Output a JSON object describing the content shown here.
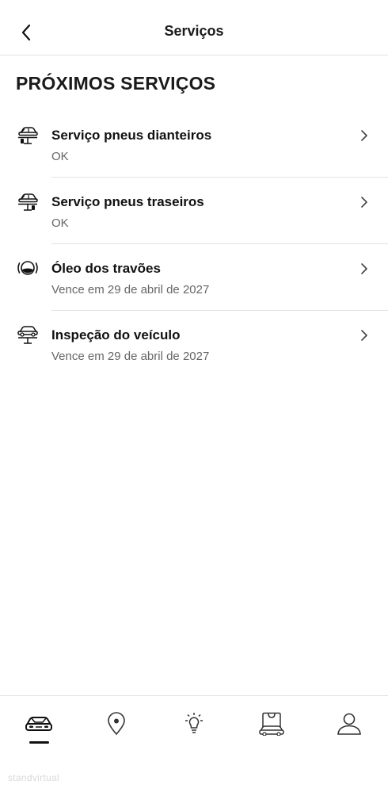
{
  "header": {
    "title": "Serviços",
    "back_icon": "chevron-left-icon"
  },
  "section": {
    "title": "PRÓXIMOS SERVIÇOS"
  },
  "services": [
    {
      "name": "Serviço pneus dianteiros",
      "status": "OK",
      "icon": "front-tyre-lift-icon"
    },
    {
      "name": "Serviço pneus traseiros",
      "status": "OK",
      "icon": "rear-tyre-lift-icon"
    },
    {
      "name": "Óleo dos travões",
      "status": "Vence em 29 de abril de 2027",
      "icon": "brake-fluid-icon"
    },
    {
      "name": "Inspeção do veículo",
      "status": "Vence em 29 de abril de 2027",
      "icon": "car-lift-icon"
    }
  ],
  "bottom_nav": {
    "items": [
      {
        "icon": "car-icon",
        "active": true
      },
      {
        "icon": "location-pin-icon",
        "active": false
      },
      {
        "icon": "lightbulb-icon",
        "active": false
      },
      {
        "icon": "shop-car-icon",
        "active": false
      },
      {
        "icon": "profile-icon",
        "active": false
      }
    ]
  },
  "watermark": "standvirtual"
}
